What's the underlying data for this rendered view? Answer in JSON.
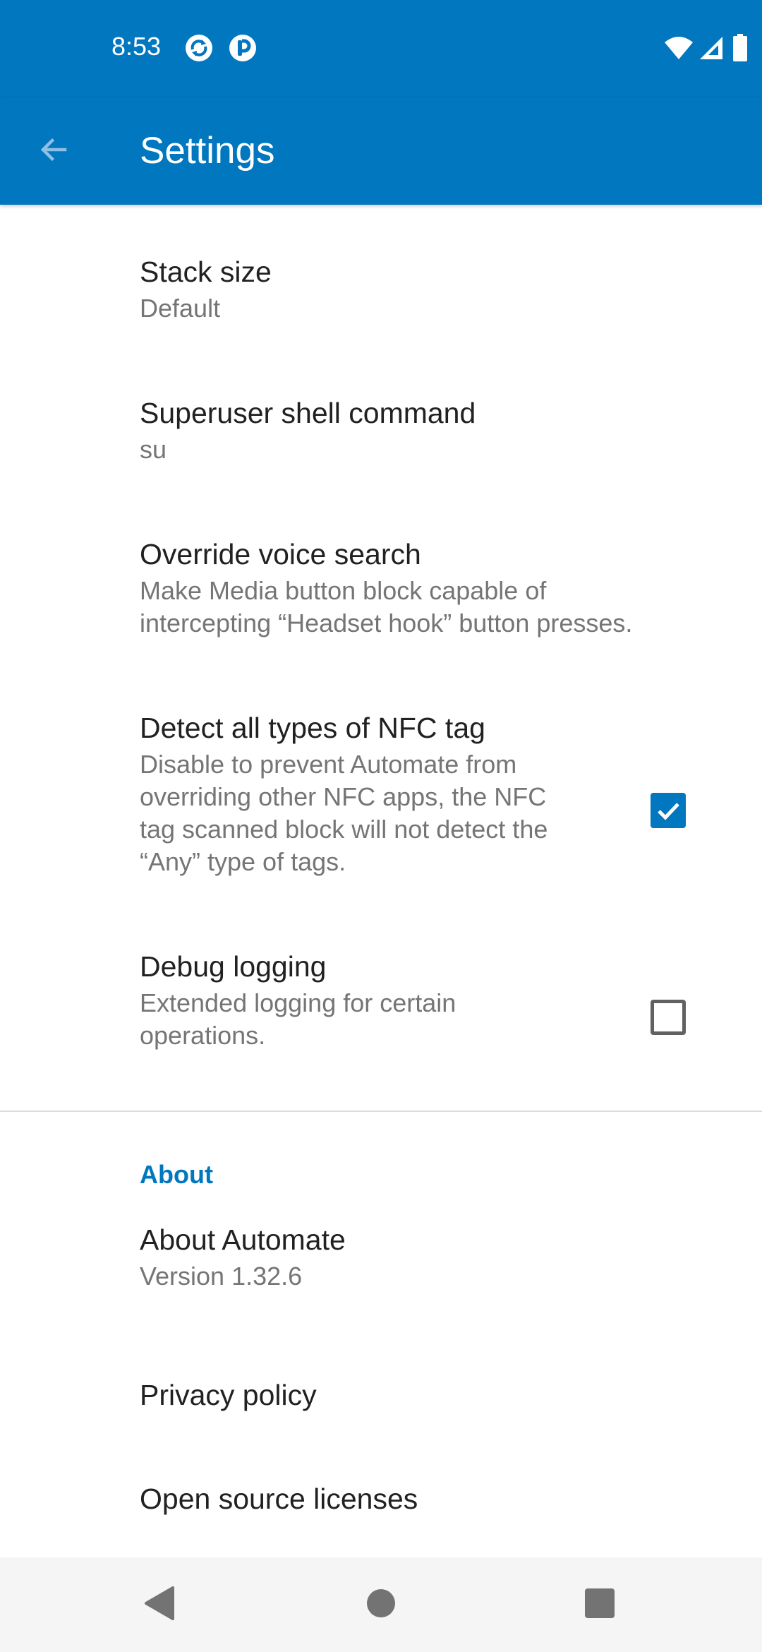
{
  "status_bar": {
    "time": "8:53",
    "icons": [
      "sync-app-icon",
      "rounded-p-app-icon",
      "wifi-icon",
      "cell-signal-icon",
      "battery-icon"
    ]
  },
  "app_bar": {
    "title": "Settings",
    "back_icon": "arrow-left-icon"
  },
  "preferences": [
    {
      "title": "Stack size",
      "summary": "Default"
    },
    {
      "title": "Superuser shell command",
      "summary": "su"
    },
    {
      "title": "Override voice search",
      "summary": "Make Media button block capable of\nintercepting “Headset hook” button presses."
    },
    {
      "title": "Detect all types of NFC tag",
      "summary": "Disable to prevent Automate from\noverriding other NFC apps, the NFC\ntag scanned block will not detect the\n“Any” type of tags.",
      "checked": true
    },
    {
      "title": "Debug logging",
      "summary": "Extended logging for certain\noperations.",
      "checked": false
    }
  ],
  "about": {
    "category_label": "About",
    "items": [
      {
        "title": "About Automate",
        "summary": "Version 1.32.6"
      },
      {
        "title": "Privacy policy"
      },
      {
        "title": "Open source licenses"
      }
    ]
  },
  "colors": {
    "accent": "#0077be",
    "title_text": "#212121",
    "summary_text": "#757575",
    "nav_bar": "#f5f5f5"
  },
  "nav_bar": {
    "icons": [
      "back-triangle-icon",
      "home-circle-icon",
      "recents-square-icon"
    ]
  }
}
